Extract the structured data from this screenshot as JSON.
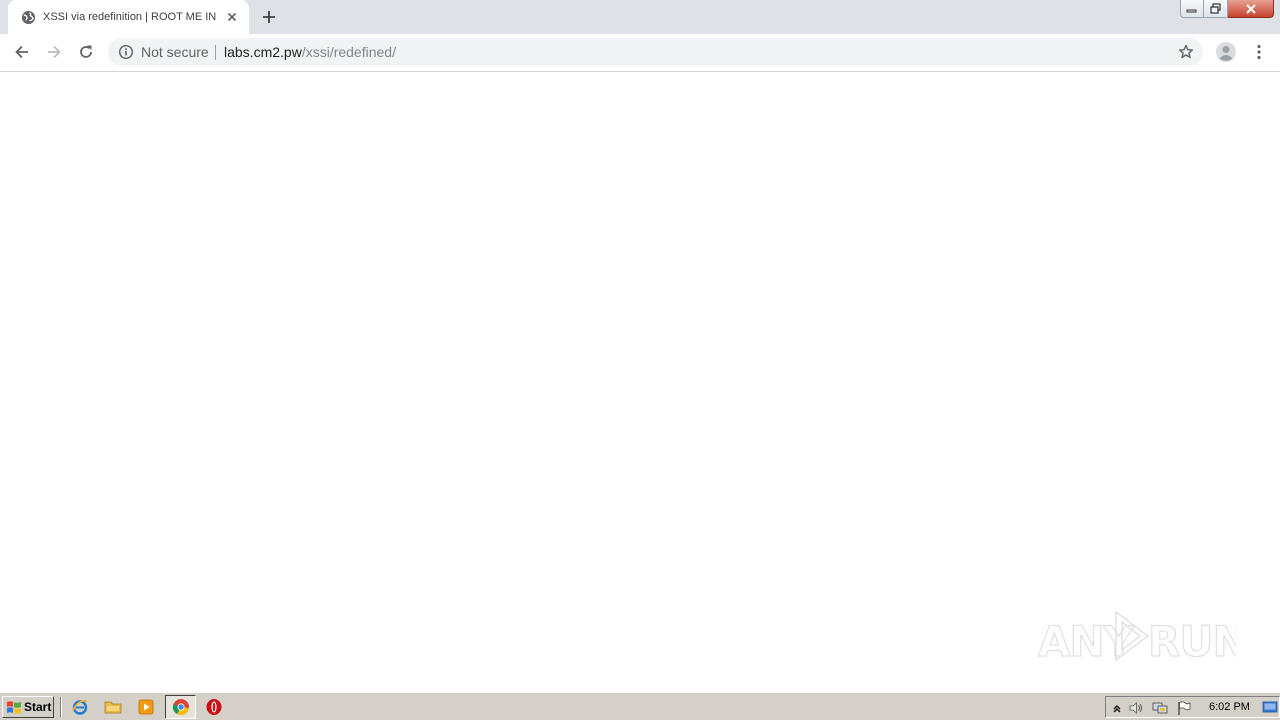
{
  "browser": {
    "tab": {
      "title": "XSSI via redefinition | ROOT ME IN",
      "favicon": "globe-icon"
    },
    "new_tab_icon": "plus-icon",
    "window_controls": [
      "minimize-icon",
      "restore-icon",
      "close-icon"
    ],
    "nav": {
      "back_icon": "arrow-left-icon",
      "forward_icon": "arrow-right-icon",
      "reload_icon": "reload-icon"
    },
    "omnibox": {
      "security_icon": "info-icon",
      "security_label": "Not secure",
      "url_host": "labs.cm2.pw",
      "url_path": "/xssi/redefined/",
      "bookmark_icon": "star-icon"
    },
    "profile_icon": "account-icon",
    "menu_icon": "kebab-menu-icon"
  },
  "page": {
    "background": "#ffffff",
    "watermark": "ANY RUN"
  },
  "taskbar": {
    "start_label": "Start",
    "quick_launch": [
      "internet-explorer-icon",
      "folder-icon",
      "media-player-icon",
      "chrome-icon",
      "opera-icon"
    ],
    "tray_icons": [
      "show-hidden-icon",
      "volume-icon",
      "network-icon",
      "flag-icon"
    ],
    "clock": "6:02 PM",
    "show_desktop_icon": "show-desktop-icon"
  },
  "colors": {
    "tabstrip": "#dee1e6",
    "omnibox": "#f1f3f4",
    "taskbar": "#d4d0c8"
  }
}
